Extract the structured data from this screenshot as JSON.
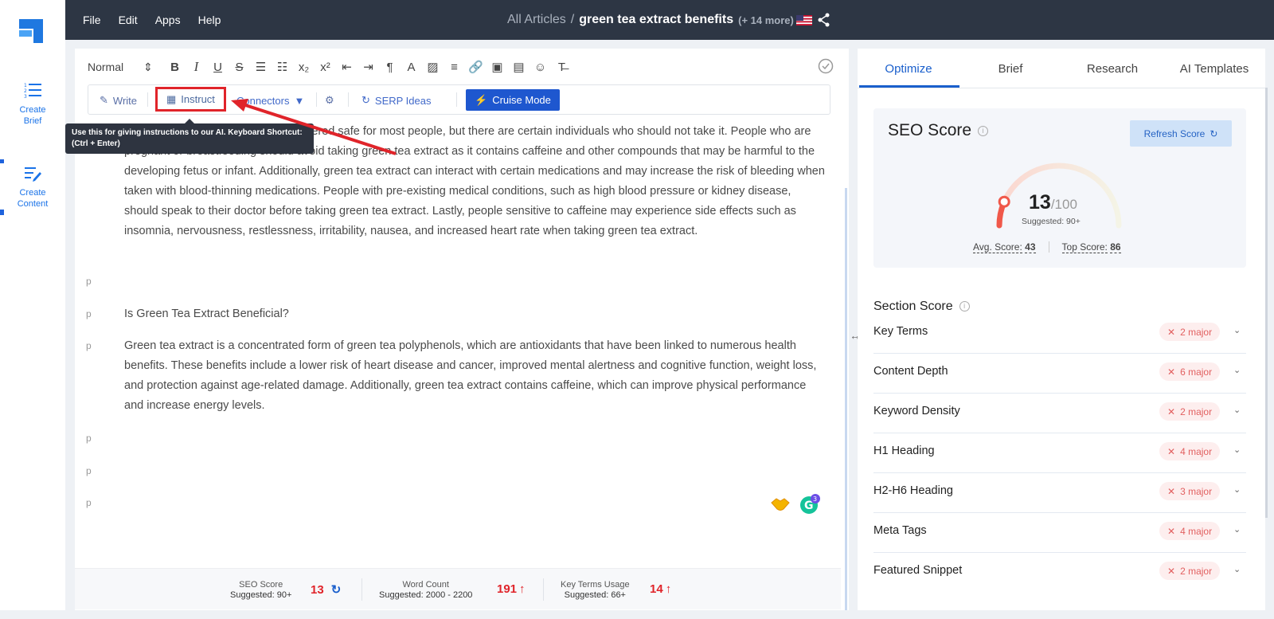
{
  "rail": {
    "items": [
      {
        "label_line1": "Create",
        "label_line2": "Brief"
      },
      {
        "label_line1": "Create",
        "label_line2": "Content"
      }
    ]
  },
  "topbar": {
    "menu": [
      "File",
      "Edit",
      "Apps",
      "Help"
    ],
    "breadcrumb_all": "All Articles",
    "breadcrumb_sep": "/",
    "breadcrumb_current": "green tea extract benefits",
    "breadcrumb_more": "(+ 14 more)"
  },
  "toolbar": {
    "style_select": "Normal",
    "write_label": "Write",
    "instruct_label": "Instruct",
    "connectors_label": "Connectors",
    "serp_label": "SERP Ideas",
    "cruise_label": "Cruise Mode"
  },
  "tooltip": {
    "line1": "Use this for giving instructions to our AI. Keyboard Shortcut:",
    "line2": "(Ctrl + Enter)"
  },
  "editor": {
    "para1": "Green tea extract is generally considered safe for most people, but there are certain individuals who should not take it. People who are pregnant or breastfeeding should avoid taking green tea extract as it contains caffeine and other compounds that may be harmful to the developing fetus or infant. Additionally, green tea extract can interact with certain medications and may increase the risk of bleeding when taken with blood-thinning medications. People with pre-existing medical conditions, such as high blood pressure or kidney disease, should speak to their doctor before taking green tea extract. Lastly, people sensitive to caffeine may experience side effects such as insomnia, nervousness, restlessness, irritability, nausea, and increased heart rate when taking green tea extract.",
    "heading2": "Is Green Tea Extract Beneficial?",
    "para2": "Green tea extract is a concentrated form of green tea polyphenols, which are antioxidants that have been linked to numerous health benefits. These benefits include a lower risk of heart disease and cancer, improved mental alertness and cognitive function, weight loss, and protection against age-related damage. Additionally, green tea extract contains caffeine, which can improve physical performance and increase energy levels.",
    "p_label": "p",
    "grammarly_count": "3"
  },
  "footer": {
    "seo_label": "SEO Score",
    "seo_sub": "Suggested: 90+",
    "seo_value": "13",
    "wc_label": "Word Count",
    "wc_sub": "Suggested: 2000 - 2200",
    "wc_value": "191",
    "kt_label": "Key Terms Usage",
    "kt_sub": "Suggested: 66+",
    "kt_value": "14"
  },
  "panel": {
    "tabs": [
      "Optimize",
      "Brief",
      "Research",
      "AI Templates"
    ],
    "seo_title": "SEO Score",
    "refresh_label": "Refresh Score",
    "score": "13",
    "score_max": "/100",
    "score_fraction": 0.13,
    "suggested": "Suggested: 90+",
    "avg_label": "Avg. Score:",
    "avg_value": "43",
    "top_label": "Top Score:",
    "top_value": "86",
    "section_title": "Section Score",
    "sections": [
      {
        "name": "Key Terms",
        "badge": "2 major"
      },
      {
        "name": "Content Depth",
        "badge": "6 major"
      },
      {
        "name": "Keyword Density",
        "badge": "2 major"
      },
      {
        "name": "H1 Heading",
        "badge": "4 major"
      },
      {
        "name": "H2-H6 Heading",
        "badge": "3 major"
      },
      {
        "name": "Meta Tags",
        "badge": "4 major"
      },
      {
        "name": "Featured Snippet",
        "badge": "2 major"
      }
    ]
  },
  "colors": {
    "accent": "#1a5fcc",
    "topbar": "#2d3644",
    "alert_red": "#e0242a"
  }
}
